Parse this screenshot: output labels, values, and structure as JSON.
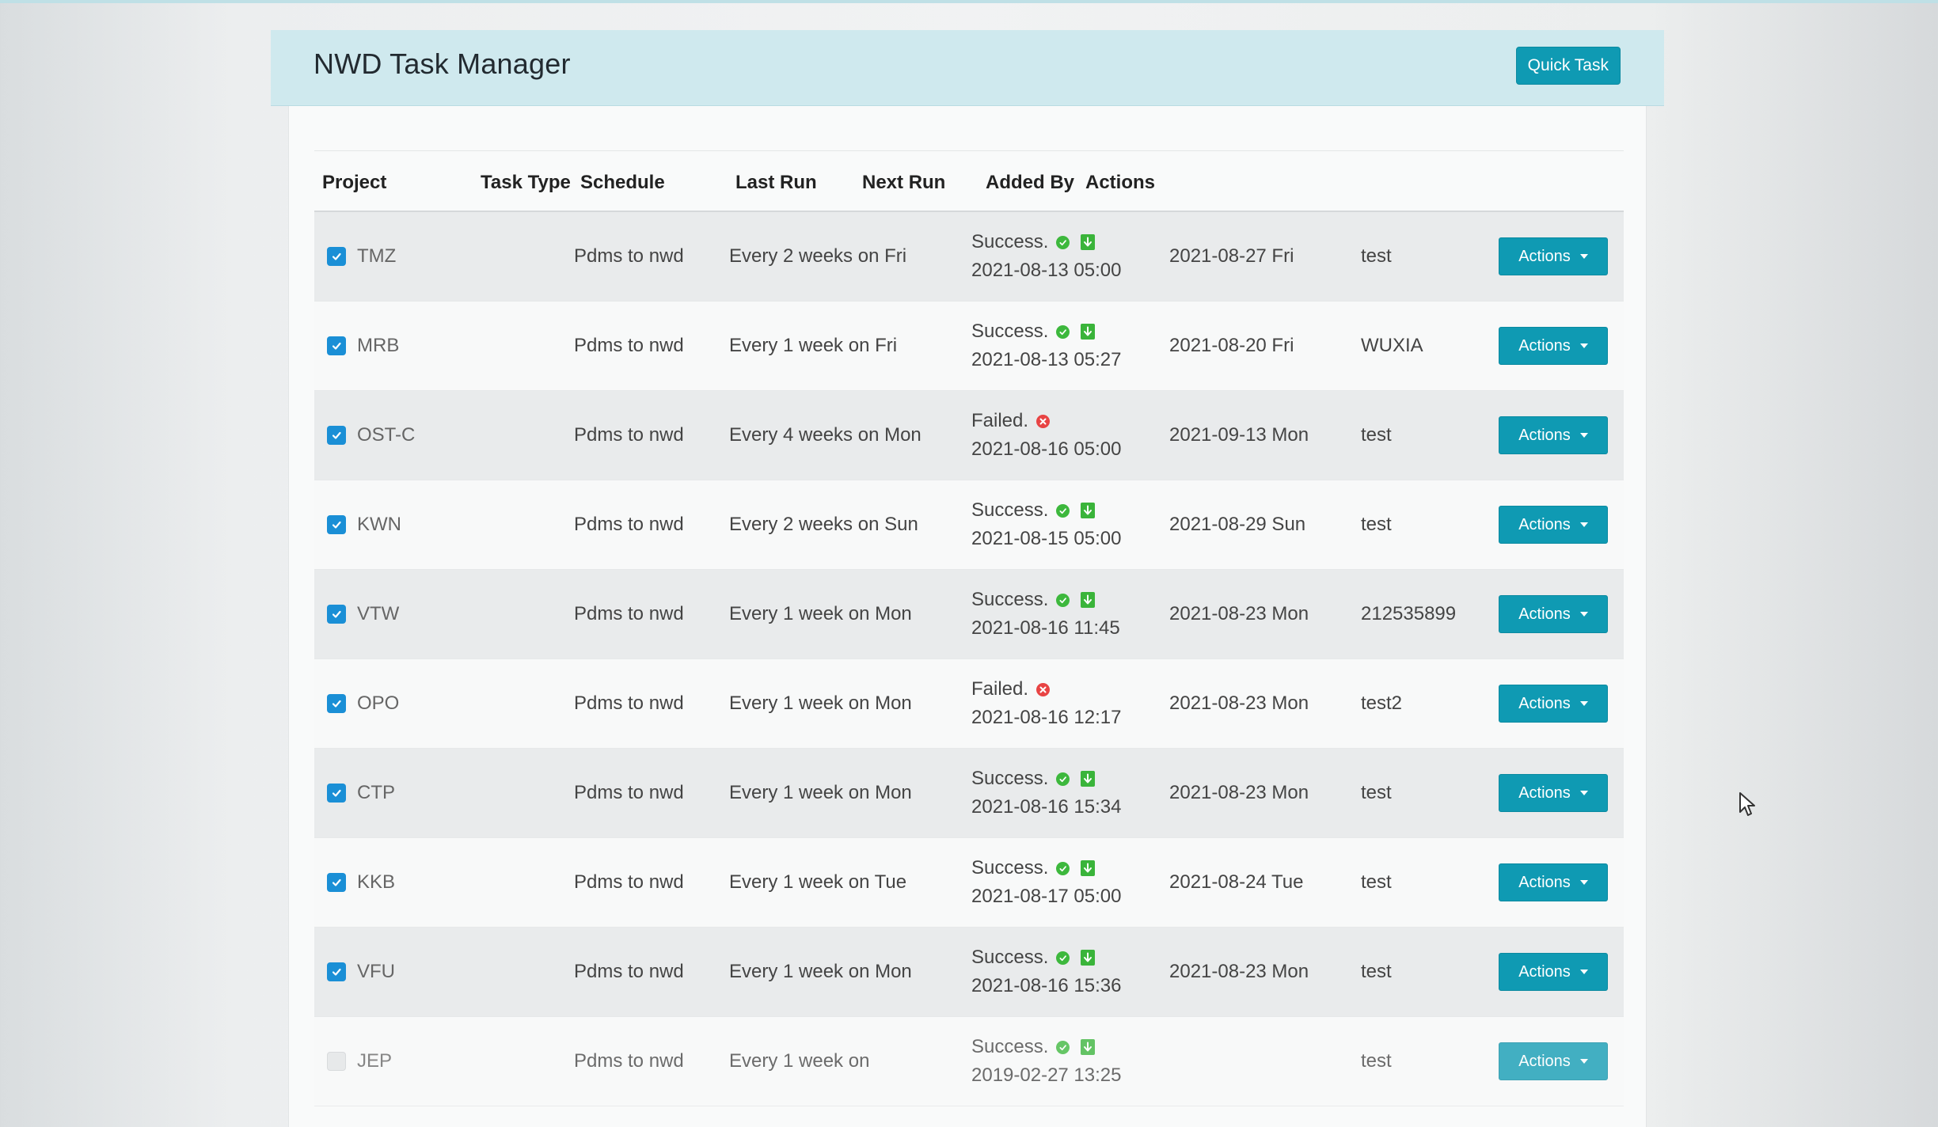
{
  "app": {
    "title": "NWD Task Manager",
    "quick_task_label": "Quick Task"
  },
  "table": {
    "headers": [
      "Project",
      "Task Type",
      "Schedule",
      "Last Run",
      "Next Run",
      "Added By",
      "Actions"
    ],
    "rows": [
      {
        "project": "TMZ",
        "checked": true,
        "task_type": "Pdms to nwd",
        "schedule": "Every 2 weeks on Fri",
        "status": "Success.",
        "last_run": "2021-08-13 05:00",
        "next_run": "2021-08-27 Fri",
        "added_by": "test",
        "actions": "Actions"
      },
      {
        "project": "MRB",
        "checked": true,
        "task_type": "Pdms to nwd",
        "schedule": "Every 1 week on Fri",
        "status": "Success.",
        "last_run": "2021-08-13 05:27",
        "next_run": "2021-08-20 Fri",
        "added_by": "WUXIA",
        "actions": "Actions"
      },
      {
        "project": "OST-C",
        "checked": true,
        "task_type": "Pdms to nwd",
        "schedule": "Every 4 weeks on Mon",
        "status": "Failed.",
        "last_run": "2021-08-16 05:00",
        "next_run": "2021-09-13 Mon",
        "added_by": "test",
        "actions": "Actions"
      },
      {
        "project": "KWN",
        "checked": true,
        "task_type": "Pdms to nwd",
        "schedule": "Every 2 weeks on Sun",
        "status": "Success.",
        "last_run": "2021-08-15 05:00",
        "next_run": "2021-08-29 Sun",
        "added_by": "test",
        "actions": "Actions"
      },
      {
        "project": "VTW",
        "checked": true,
        "task_type": "Pdms to nwd",
        "schedule": "Every 1 week on Mon",
        "status": "Success.",
        "last_run": "2021-08-16 11:45",
        "next_run": "2021-08-23 Mon",
        "added_by": "212535899",
        "actions": "Actions"
      },
      {
        "project": "OPO",
        "checked": true,
        "task_type": "Pdms to nwd",
        "schedule": "Every 1 week on Mon",
        "status": "Failed.",
        "last_run": "2021-08-16 12:17",
        "next_run": "2021-08-23 Mon",
        "added_by": "test2",
        "actions": "Actions"
      },
      {
        "project": "CTP",
        "checked": true,
        "task_type": "Pdms to nwd",
        "schedule": "Every 1 week on Mon",
        "status": "Success.",
        "last_run": "2021-08-16 15:34",
        "next_run": "2021-08-23 Mon",
        "added_by": "test",
        "actions": "Actions"
      },
      {
        "project": "KKB",
        "checked": true,
        "task_type": "Pdms to nwd",
        "schedule": "Every 1 week on Tue",
        "status": "Success.",
        "last_run": "2021-08-17 05:00",
        "next_run": "2021-08-24 Tue",
        "added_by": "test",
        "actions": "Actions"
      },
      {
        "project": "VFU",
        "checked": true,
        "task_type": "Pdms to nwd",
        "schedule": "Every 1 week on Mon",
        "status": "Success.",
        "last_run": "2021-08-16 15:36",
        "next_run": "2021-08-23 Mon",
        "added_by": "test",
        "actions": "Actions"
      },
      {
        "project": "JEP",
        "checked": false,
        "task_type": "Pdms to nwd",
        "schedule": "Every 1 week on",
        "status": "Success.",
        "last_run": "2019-02-27 13:25",
        "next_run": "",
        "added_by": "test",
        "actions": "Actions"
      }
    ]
  },
  "colors": {
    "accent": "#0f9ab3",
    "header_bg": "#cfe9ee",
    "checkbox": "#1a8fd6",
    "success": "#3db83d",
    "failed": "#e84444"
  },
  "icons": {
    "success": "check-circle-icon",
    "failed": "x-circle-icon",
    "download": "download-icon",
    "checkbox": "checkbox-icon",
    "dropdown": "caret-down-icon",
    "pointer": "mouse-pointer-icon"
  }
}
